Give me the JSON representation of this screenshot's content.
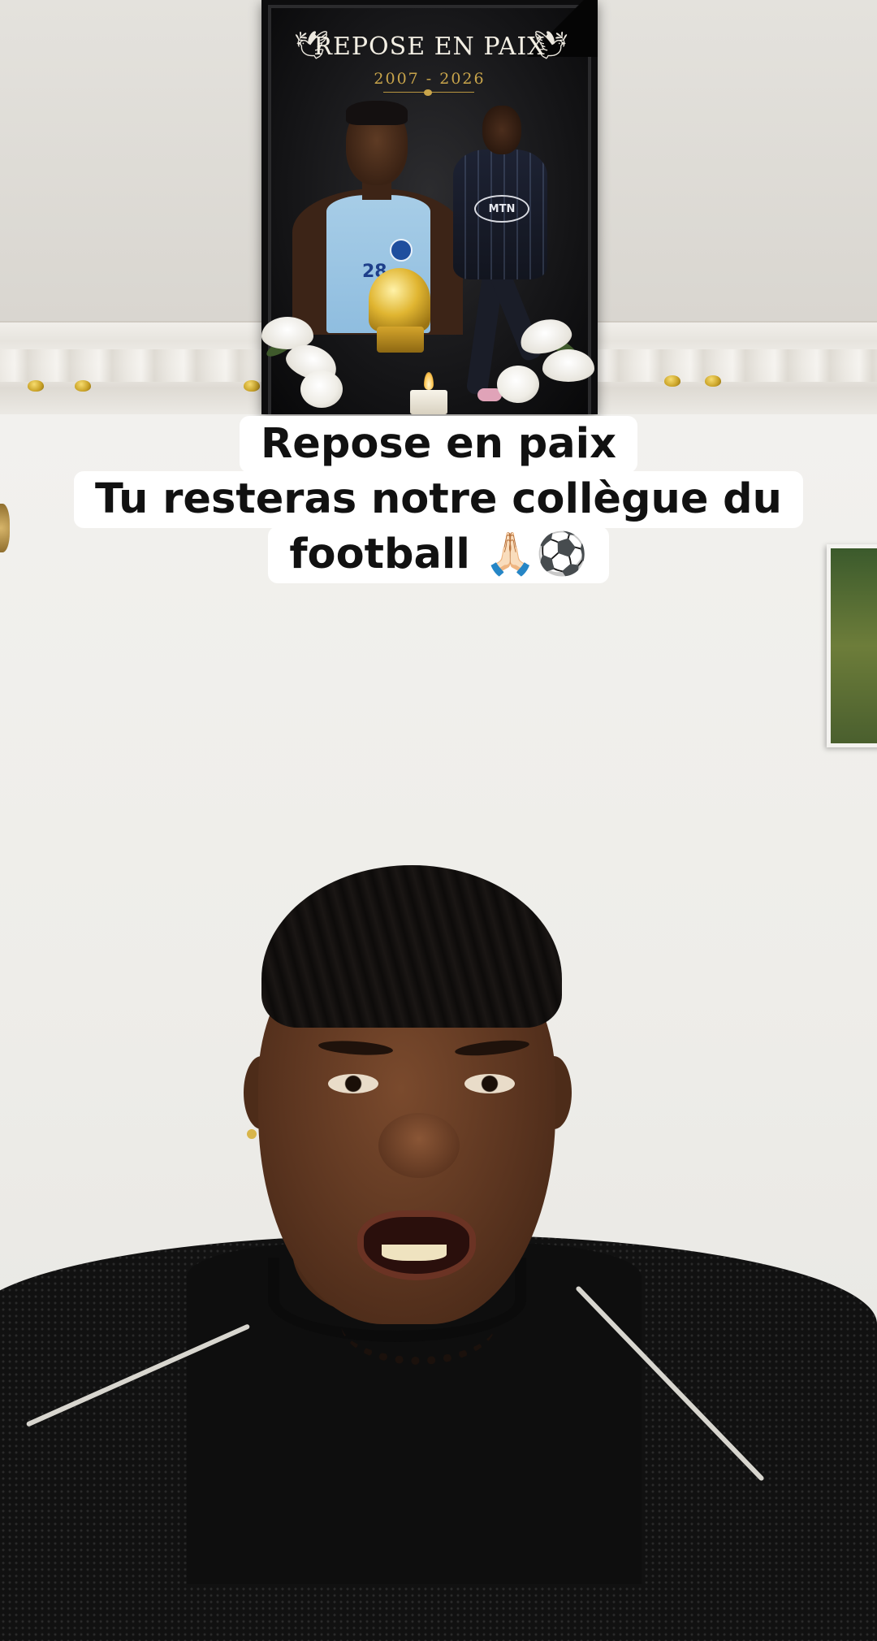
{
  "poster": {
    "title": "REPOSE EN PAIX",
    "years": "2007 - 2026",
    "player_number": "28",
    "sponsor": "MTN",
    "dove_icon": "🕊"
  },
  "caption": {
    "line1": "Repose en paix",
    "line2": "Tu resteras notre collègue du",
    "line3": "football 🙏🏻⚽"
  },
  "colors": {
    "caption_bg": "#ffffff",
    "caption_text": "#111111",
    "poster_gold": "#c9a54b"
  }
}
